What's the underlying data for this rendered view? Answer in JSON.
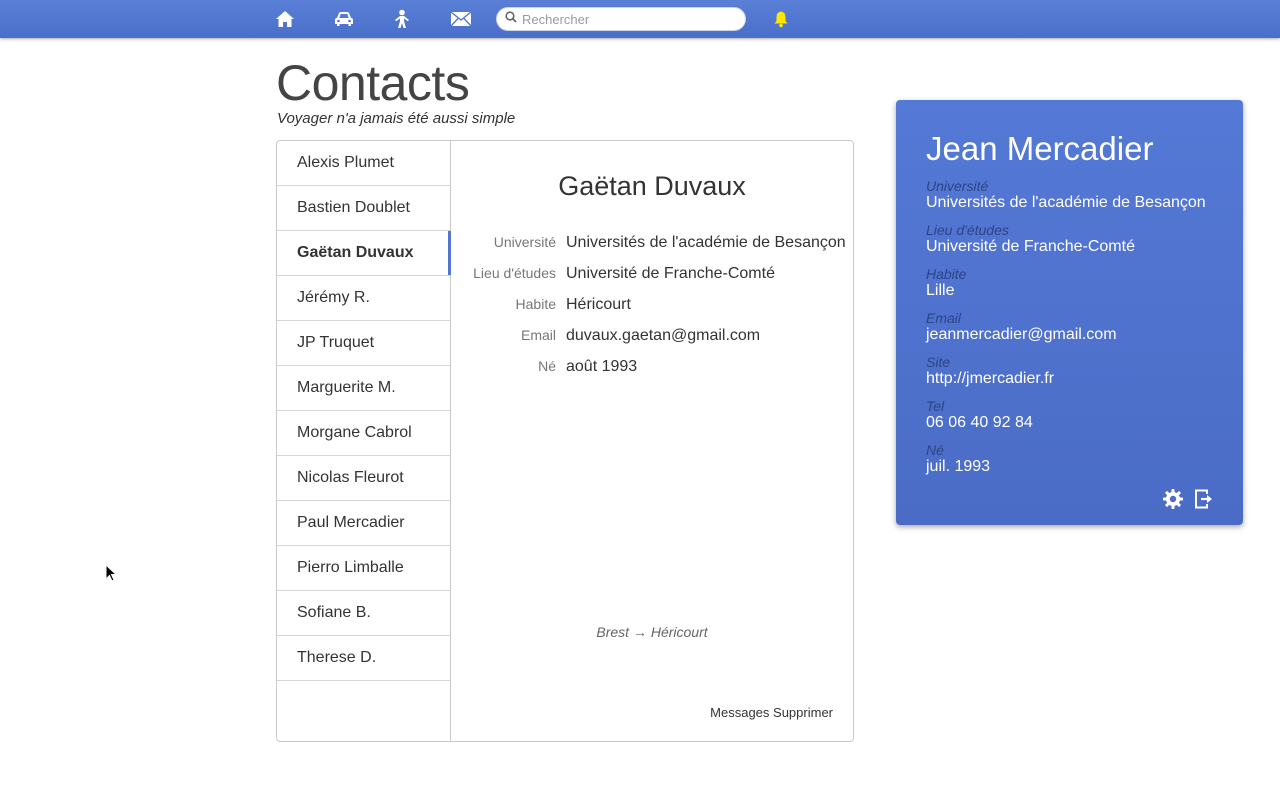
{
  "nav": {
    "icons": [
      "home-icon",
      "car-icon",
      "person-icon",
      "mail-icon",
      "bell-icon"
    ],
    "search_placeholder": "Rechercher",
    "bell_color": "#ffe600"
  },
  "page": {
    "title": "Contacts",
    "subtitle": "Voyager n'a jamais été aussi simple"
  },
  "contacts": [
    {
      "name": "Alexis Plumet"
    },
    {
      "name": "Bastien Doublet"
    },
    {
      "name": "Gaëtan Duvaux",
      "active": true
    },
    {
      "name": "Jérémy R."
    },
    {
      "name": "JP Truquet"
    },
    {
      "name": "Marguerite M."
    },
    {
      "name": "Morgane Cabrol"
    },
    {
      "name": "Nicolas Fleurot"
    },
    {
      "name": "Paul Mercadier"
    },
    {
      "name": "Pierro Limballe"
    },
    {
      "name": "Sofiane B."
    },
    {
      "name": "Therese D."
    }
  ],
  "detail": {
    "name": "Gaëtan Duvaux",
    "fields": [
      {
        "label": "Université",
        "value": "Universités de l'académie de Besançon"
      },
      {
        "label": "Lieu d'études",
        "value": "Université de Franche-Comté"
      },
      {
        "label": "Habite",
        "value": "Héricourt"
      },
      {
        "label": "Email",
        "value": "duvaux.gaetan@gmail.com"
      },
      {
        "label": "Né",
        "value": "août 1993"
      }
    ],
    "route": "Brest → Héricourt",
    "messages_label": "Messages",
    "delete_label": "Supprimer"
  },
  "profile": {
    "name": "Jean Mercadier",
    "fields": [
      {
        "label": "Université",
        "value": "Universités de l'académie de Besançon"
      },
      {
        "label": "Lieu d'études",
        "value": "Université de Franche-Comté"
      },
      {
        "label": "Habite",
        "value": "Lille"
      },
      {
        "label": "Email",
        "value": "jeanmercadier@gmail.com"
      },
      {
        "label": "Site",
        "value": "http://jmercadier.fr"
      },
      {
        "label": "Tel",
        "value": "06 06 40 92 84"
      },
      {
        "label": "Né",
        "value": "juil. 1993"
      }
    ],
    "icons": [
      "gear-icon",
      "logout-icon"
    ],
    "accent": "#4f72cf"
  }
}
